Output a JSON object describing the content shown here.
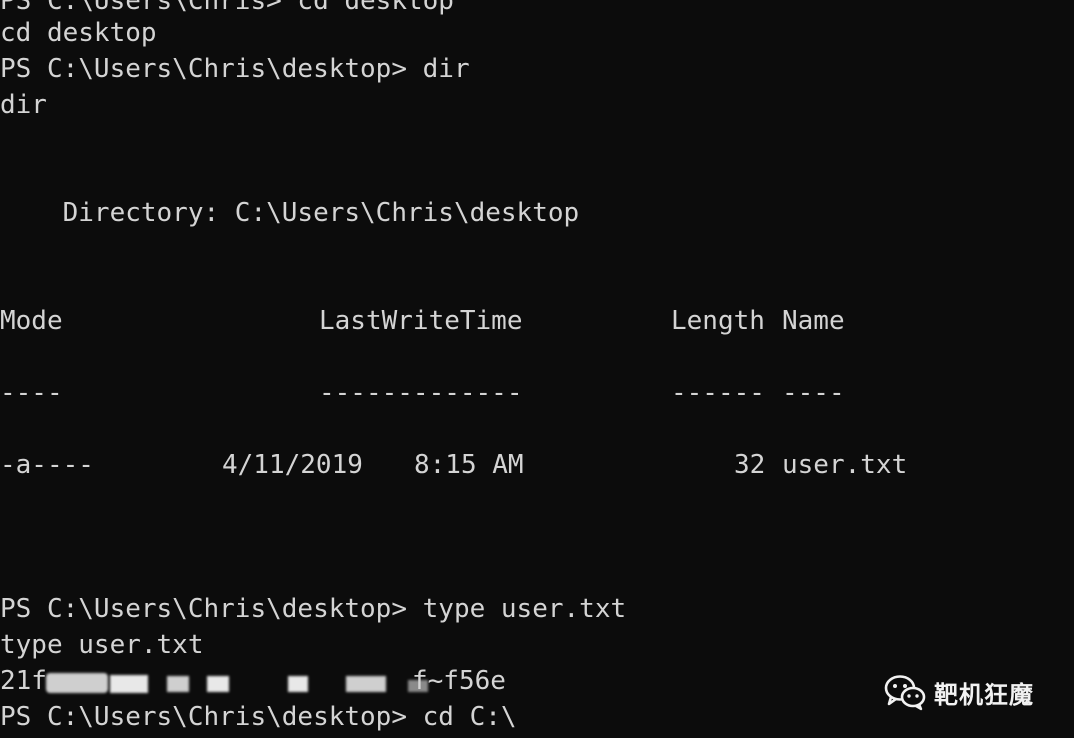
{
  "terminal": {
    "lines": [
      "PS C:\\Users\\Chris> cd desktop",
      "cd desktop",
      "PS C:\\Users\\Chris\\desktop> dir",
      "dir",
      "    Directory: C:\\Users\\Chris\\desktop"
    ],
    "table": {
      "headers": {
        "mode": "Mode",
        "last_write_time": "LastWriteTime",
        "length": "Length",
        "name": "Name"
      },
      "separators": {
        "mode": "----",
        "last_write_time": "-------------",
        "length": "------",
        "name": "----"
      },
      "rows": [
        {
          "mode": "-a----",
          "date": "4/11/2019",
          "time": "8:15 AM",
          "length": "32",
          "name": "user.txt"
        }
      ]
    },
    "after_table": [
      "PS C:\\Users\\Chris\\desktop> type user.txt",
      "type user.txt"
    ],
    "flag": {
      "prefix": "21f",
      "suffix": "f~f56e"
    },
    "last_prompt": "PS C:\\Users\\Chris\\desktop> cd C:\\"
  },
  "watermark": {
    "text": "靶机狂魔",
    "icon": "wechat-icon"
  }
}
